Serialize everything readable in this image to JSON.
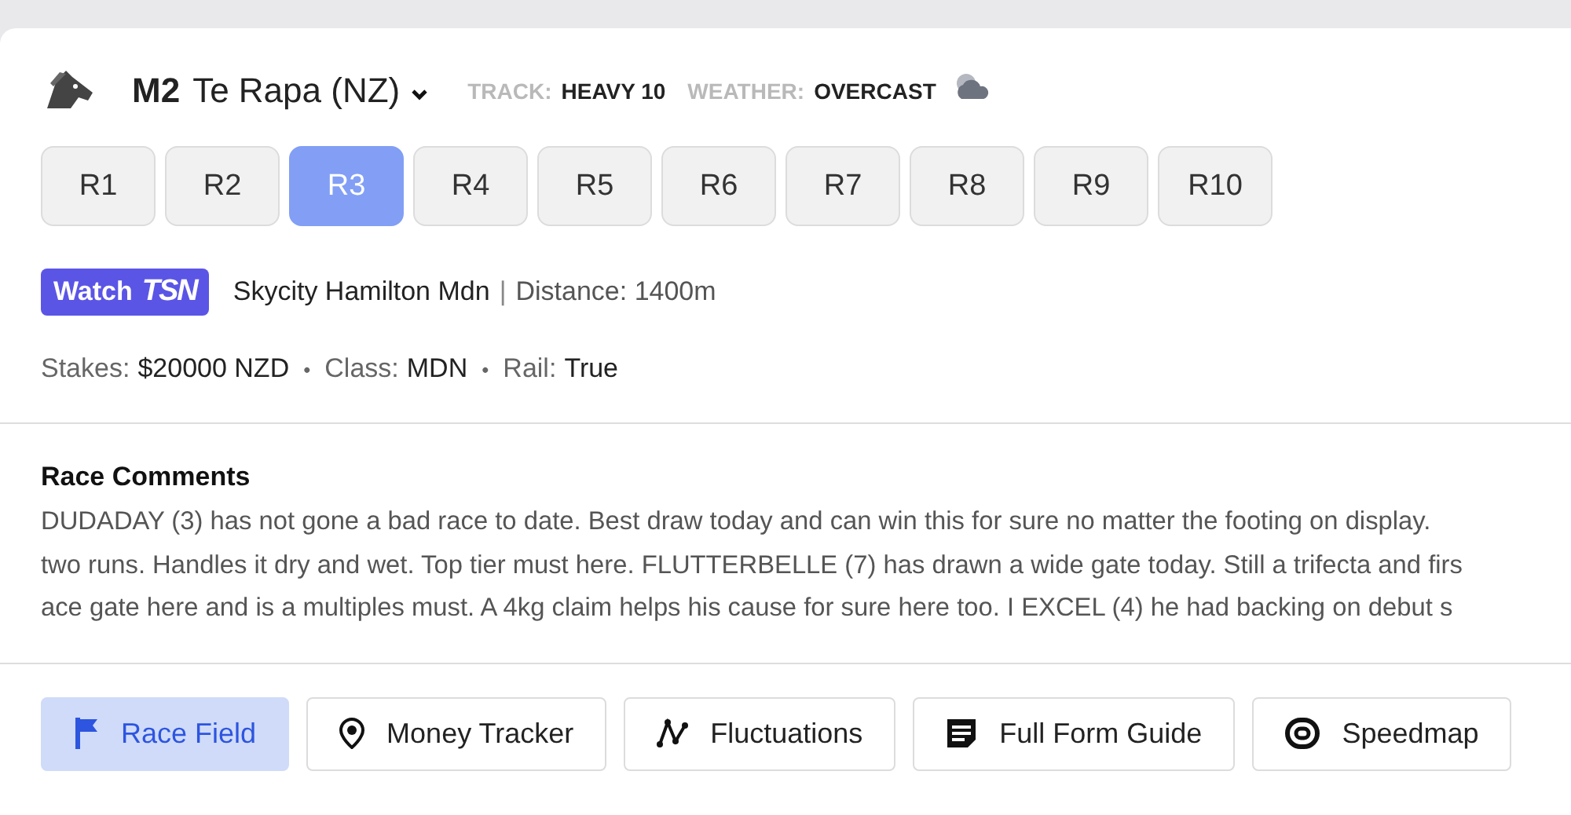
{
  "meeting": {
    "code": "M2",
    "venue": "Te Rapa (NZ)",
    "track_label": "TRACK:",
    "track": "HEAVY 10",
    "weather_label": "WEATHER:",
    "weather": "OVERCAST"
  },
  "races": [
    {
      "label": "R1",
      "selected": false
    },
    {
      "label": "R2",
      "selected": false
    },
    {
      "label": "R3",
      "selected": true
    },
    {
      "label": "R4",
      "selected": false
    },
    {
      "label": "R5",
      "selected": false
    },
    {
      "label": "R6",
      "selected": false
    },
    {
      "label": "R7",
      "selected": false
    },
    {
      "label": "R8",
      "selected": false
    },
    {
      "label": "R9",
      "selected": false
    },
    {
      "label": "R10",
      "selected": false
    }
  ],
  "watch": {
    "label": "Watch",
    "brand": "TSN"
  },
  "race": {
    "name": "Skycity Hamilton Mdn",
    "separator": "|",
    "distance": "Distance: 1400m"
  },
  "details": [
    {
      "label": "Stakes:",
      "value": "$20000 NZD"
    },
    {
      "label": "Class:",
      "value": "MDN"
    },
    {
      "label": "Rail:",
      "value": "True"
    }
  ],
  "details_separator": "•",
  "comments": {
    "title": "Race Comments",
    "lines": [
      "DUDADAY (3) has not gone a bad race to date. Best draw today and can win this for sure no matter the footing on display.",
      "two runs. Handles it dry and wet. Top tier must here. FLUTTERBELLE (7) has drawn a wide gate today. Still a trifecta and firs",
      "ace gate here and is a multiples must. A 4kg claim helps his cause for sure here too. I EXCEL (4) he had backing on debut s"
    ]
  },
  "sections": [
    {
      "label": "Race Field",
      "kind": "flag",
      "selected": true
    },
    {
      "label": "Money Tracker",
      "kind": "pin",
      "selected": false
    },
    {
      "label": "Fluctuations",
      "kind": "chart",
      "selected": false
    },
    {
      "label": "Full Form Guide",
      "kind": "form",
      "selected": false
    },
    {
      "label": "Speedmap",
      "kind": "speedmap",
      "selected": false
    }
  ]
}
